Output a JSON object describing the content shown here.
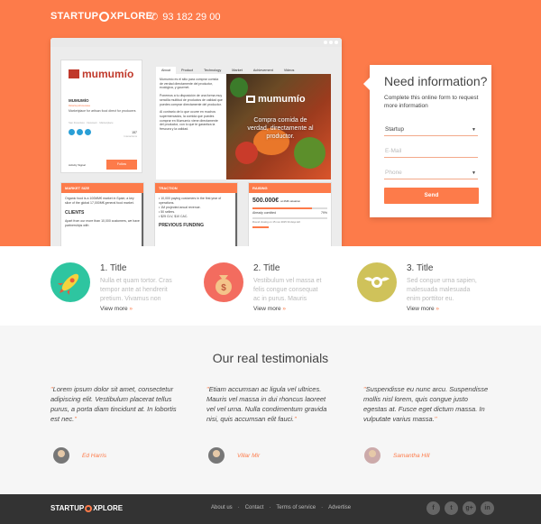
{
  "header": {
    "logo_left": "STARTUP",
    "logo_right": "XPLORE",
    "phone_icon": "phone-icon",
    "phone": "93 182 29 00"
  },
  "profile": {
    "brand": "mumumío",
    "name": "MUMUMÍO",
    "tagline": "#startupshowcase",
    "description": "Marketplace for artisan food direct for producers",
    "location": "San Francisco · Newtown · Marketplace",
    "count": "157",
    "count_label": "Interactions",
    "activity_signal": "Activity Signal",
    "follow": "Follow"
  },
  "tabs": [
    "About",
    "Product",
    "Technology",
    "Market",
    "Achievement",
    "Videos"
  ],
  "about": {
    "p1": "Mumumío es el sitio para comprar comida de verdad directamente del productor, ecológica, y gourmet.",
    "p2": "Ponemos a tu disposición de una forma muy sencilla multitud de productos de calidad que puedes comprar directamente del productor.",
    "p3": "Al contrario de lo que ocurre en muchos supermercados, la comida que puedes comprar en Mumumío viene directamente del productor, con lo que te garantiza la frescura y la calidad."
  },
  "hero_image": {
    "brand": "mumumío",
    "tagline": "Compra comida de verdad, directamente al productor."
  },
  "cards": {
    "market": {
      "title": "MARKET SIZE",
      "text": "Organic food is a 100MM€ market in Spain; a key slice of the global 17,000M€ general food market.",
      "sub": "CLIENTS",
      "text2": "Apart from our more than 10,000 customers, we have partnerships with"
    },
    "traction": {
      "title": "TRACTION",
      "items": [
        "10,000 paying customers in the first year of operations.",
        "1M projected anual revenue.",
        "50 sellers.",
        "$25 CLV, $10 CAC."
      ],
      "sub": "PREVIOUS FUNDING"
    },
    "raising": {
      "title": "RAISING",
      "amount": "500.000€",
      "valuation": "at 2M€ valuation",
      "committed_label": "Already comitted",
      "committed_pct": "79%",
      "committed_fraction": 0.79,
      "closing": "Round closing on 15 nov 2015 34 days left"
    }
  },
  "form": {
    "title": "Need information?",
    "description": "Complete this online form to request more information",
    "select_value": "Startup",
    "email_placeholder": "E-Mail",
    "phone_placeholder": "Phone",
    "send": "Send"
  },
  "features": [
    {
      "icon": "rocket-icon",
      "title": "1. Title",
      "text": "Nulla et quam tortor. Cras tempor ante at hendrerit pretium. Vivamus non erat a",
      "more": "View more",
      "color": "#2ec5a0"
    },
    {
      "icon": "money-bag-icon",
      "title": "2. Title",
      "text": "Vestibulum vel massa et felis congue consequat ac in purus. Mauris tristique non erat at",
      "more": "View more",
      "color": "#f36c5f"
    },
    {
      "icon": "winged-badge-icon",
      "title": "3. Title",
      "text": "Sed congue urna sapien, malesuada malesuada enim porttitor eu. Interdum et",
      "more": "View more",
      "color": "#cfc25a"
    }
  ],
  "testimonials": {
    "heading": "Our real testimonials",
    "items": [
      {
        "quote": "Lorem ipsum dolor sit amet, consectetur adipiscing elit. Vestibulum placerat tellus purus, a porta diam tincidunt at. In lobortis est nec.",
        "name": "Ed Harris"
      },
      {
        "quote": "Etiam accumsan ac ligula vel ultrices. Mauris vel massa in dui rhoncus laoreet vel vel urna. Nulla condimentum gravida nisi, quis accumsan elit fauci.",
        "name": "Villar Mir"
      },
      {
        "quote": "Suspendisse eu nunc arcu. Suspendisse mollis nisl lorem, quis congue justo egestas at. Fusce eget dictum massa. In vulputate varius massa.",
        "name": "Samantha Hill"
      }
    ]
  },
  "footer": {
    "logo_left": "STARTUP",
    "logo_right": "XPLORE",
    "links": [
      "About us",
      "Contact",
      "Terms of service",
      "Advertise"
    ],
    "social": [
      {
        "icon": "facebook-icon",
        "glyph": "f"
      },
      {
        "icon": "twitter-icon",
        "glyph": "t"
      },
      {
        "icon": "google-plus-icon",
        "glyph": "g+"
      },
      {
        "icon": "linkedin-icon",
        "glyph": "in"
      }
    ]
  },
  "colors": {
    "accent": "#fd7b4a",
    "footer": "#333333"
  }
}
